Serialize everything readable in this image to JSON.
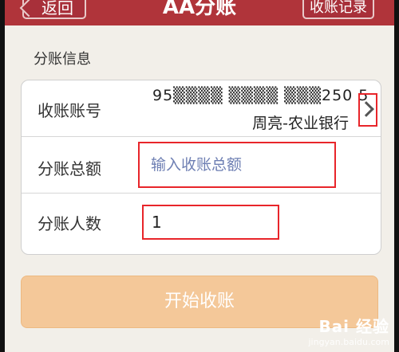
{
  "header": {
    "back_label": "返回",
    "title": "AA分账",
    "record_label": "收账记录"
  },
  "section_title": "分账信息",
  "form": {
    "account_label": "收账账号",
    "account_number": "95▒▒▒▒ ▒▒▒▒ ▒▒▒250 5",
    "account_owner": "周亮-农业银行",
    "amount_label": "分账总额",
    "amount_placeholder": "输入收账总额",
    "count_label": "分账人数",
    "count_value": "1"
  },
  "start_button_label": "开始收账",
  "watermark": {
    "brand": "Bai 经验",
    "domain": "jingyan.baidu.com"
  },
  "colors": {
    "header_bg": "#b0343a",
    "highlight_box": "#e8252a",
    "start_button_bg": "#f4c899"
  }
}
